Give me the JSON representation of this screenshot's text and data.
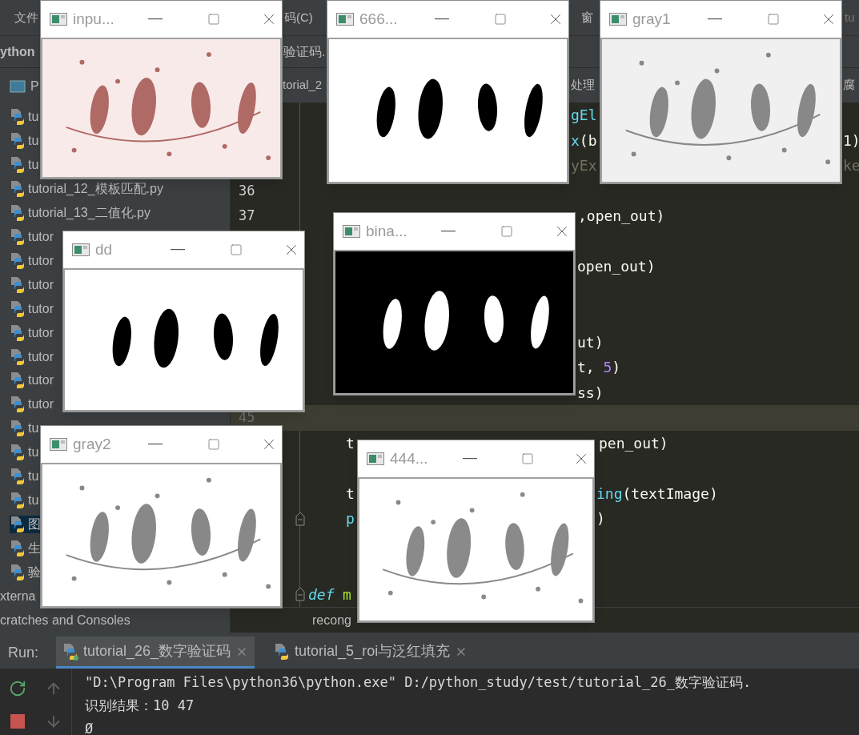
{
  "menu_bar": {
    "items": [
      "文件",
      "码(C)",
      "窗",
      "tu"
    ]
  },
  "nav_bar": {
    "items": [
      "ython",
      "验证码."
    ]
  },
  "project_panel": {
    "title": "P",
    "items": [
      {
        "label": "tu",
        "kind": "file",
        "selected": false
      },
      {
        "label": "tu",
        "kind": "file",
        "selected": false
      },
      {
        "label": "tu",
        "kind": "file",
        "selected": false
      },
      {
        "label": "tutorial_12_模板匹配.py",
        "kind": "file",
        "selected": false
      },
      {
        "label": "tutorial_13_二值化.py",
        "kind": "file",
        "selected": false
      },
      {
        "label": "tutor",
        "kind": "file",
        "selected": false
      },
      {
        "label": "tutor",
        "kind": "file",
        "selected": false
      },
      {
        "label": "tutor",
        "kind": "file",
        "selected": false
      },
      {
        "label": "tutor",
        "kind": "file",
        "selected": false
      },
      {
        "label": "tutor",
        "kind": "file",
        "selected": false
      },
      {
        "label": "tutor",
        "kind": "file",
        "selected": false
      },
      {
        "label": "tutor",
        "kind": "file",
        "selected": false
      },
      {
        "label": "tutor",
        "kind": "file",
        "selected": false
      },
      {
        "label": "tu",
        "kind": "file",
        "selected": false
      },
      {
        "label": "tu",
        "kind": "file",
        "selected": false
      },
      {
        "label": "tu",
        "kind": "file",
        "selected": false
      },
      {
        "label": "tu",
        "kind": "file",
        "selected": false
      },
      {
        "label": "图",
        "kind": "file",
        "selected": true
      },
      {
        "label": "生",
        "kind": "file",
        "selected": false
      },
      {
        "label": "验",
        "kind": "file",
        "selected": false
      },
      {
        "label": "xterna",
        "kind": "library",
        "selected": false
      },
      {
        "label": "cratches and Consoles",
        "kind": "library",
        "selected": false
      }
    ]
  },
  "editor": {
    "tabs": [
      "torial_2",
      "处理",
      "腐"
    ],
    "lines": [
      {
        "current": false,
        "segments": [
          [
            {
              "text": "gEl",
              "kind": "function"
            }
          ]
        ]
      },
      {
        "current": false,
        "segments": [
          [
            {
              "text": "x",
              "kind": "function"
            },
            {
              "text": "(b",
              "kind": "plain"
            }
          ],
          [
            {
              "text": "1)",
              "kind": "plain"
            }
          ]
        ]
      },
      {
        "current": false,
        "segments": [
          [
            {
              "text": "yEx",
              "kind": "comment"
            }
          ],
          [
            {
              "text": "ke",
              "kind": "comment"
            }
          ]
        ]
      },
      {
        "current": false,
        "number": "36"
      },
      {
        "current": false,
        "number": "37",
        "segments": [
          [
            {
              "text": ",open_out)",
              "kind": "plain"
            }
          ]
        ]
      },
      {
        "current": false
      },
      {
        "current": false,
        "segments": [
          [
            {
              "text": "open_out)",
              "kind": "plain"
            }
          ]
        ]
      },
      {
        "current": false
      },
      {
        "current": false
      },
      {
        "current": false,
        "segments": [
          [
            {
              "text": "ut)",
              "kind": "plain"
            }
          ]
        ]
      },
      {
        "current": false,
        "segments": [
          [
            {
              "text": "t, ",
              "kind": "plain"
            },
            {
              "text": "5",
              "kind": "number"
            },
            {
              "text": ")",
              "kind": "plain"
            }
          ]
        ]
      },
      {
        "current": false,
        "segments": [
          [
            {
              "text": "ss)",
              "kind": "plain"
            }
          ]
        ]
      },
      {
        "current": true,
        "number": "45"
      },
      {
        "current": false,
        "segments": [
          [
            {
              "text": "t",
              "kind": "plain"
            }
          ],
          [
            {
              "text": "pen_out)",
              "kind": "plain"
            }
          ]
        ]
      },
      {
        "current": false
      },
      {
        "current": false,
        "segments": [
          [
            {
              "text": "t",
              "kind": "plain"
            }
          ],
          [
            {
              "text": "ing",
              "kind": "function"
            },
            {
              "text": "(textImage)",
              "kind": "plain"
            }
          ]
        ]
      },
      {
        "current": false,
        "segments": [
          [
            {
              "text": "p",
              "kind": "function"
            }
          ],
          [
            {
              "text": ")",
              "kind": "plain"
            }
          ]
        ]
      },
      {
        "current": false
      },
      {
        "current": false
      },
      {
        "current": false,
        "segments": [
          [
            {
              "text": "def",
              "kind": "keyword"
            }
          ],
          [
            {
              "text": "m",
              "kind": "name"
            }
          ]
        ]
      }
    ],
    "breadcrumb": "recong"
  },
  "image_windows": [
    {
      "title": "inpu...",
      "kind": "picture"
    },
    {
      "title": "666...",
      "kind": "picture"
    },
    {
      "title": "gray1",
      "kind": "picture"
    },
    {
      "title": "dd",
      "kind": "picture"
    },
    {
      "title": "bina...",
      "kind": "picture"
    },
    {
      "title": "gray2",
      "kind": "picture"
    },
    {
      "title": "444...",
      "kind": "picture"
    }
  ],
  "run_panel": {
    "label": "Run:",
    "tabs": [
      {
        "label": "tutorial_26_数字验证码",
        "selected": true
      },
      {
        "label": "tutorial_5_roi与泛红填充",
        "selected": false
      }
    ],
    "console": [
      "\"D:\\Program Files\\python36\\python.exe\" D:/python_study/test/tutorial_26_数字验证码.",
      "识别结果：10 47",
      "Ø"
    ]
  }
}
